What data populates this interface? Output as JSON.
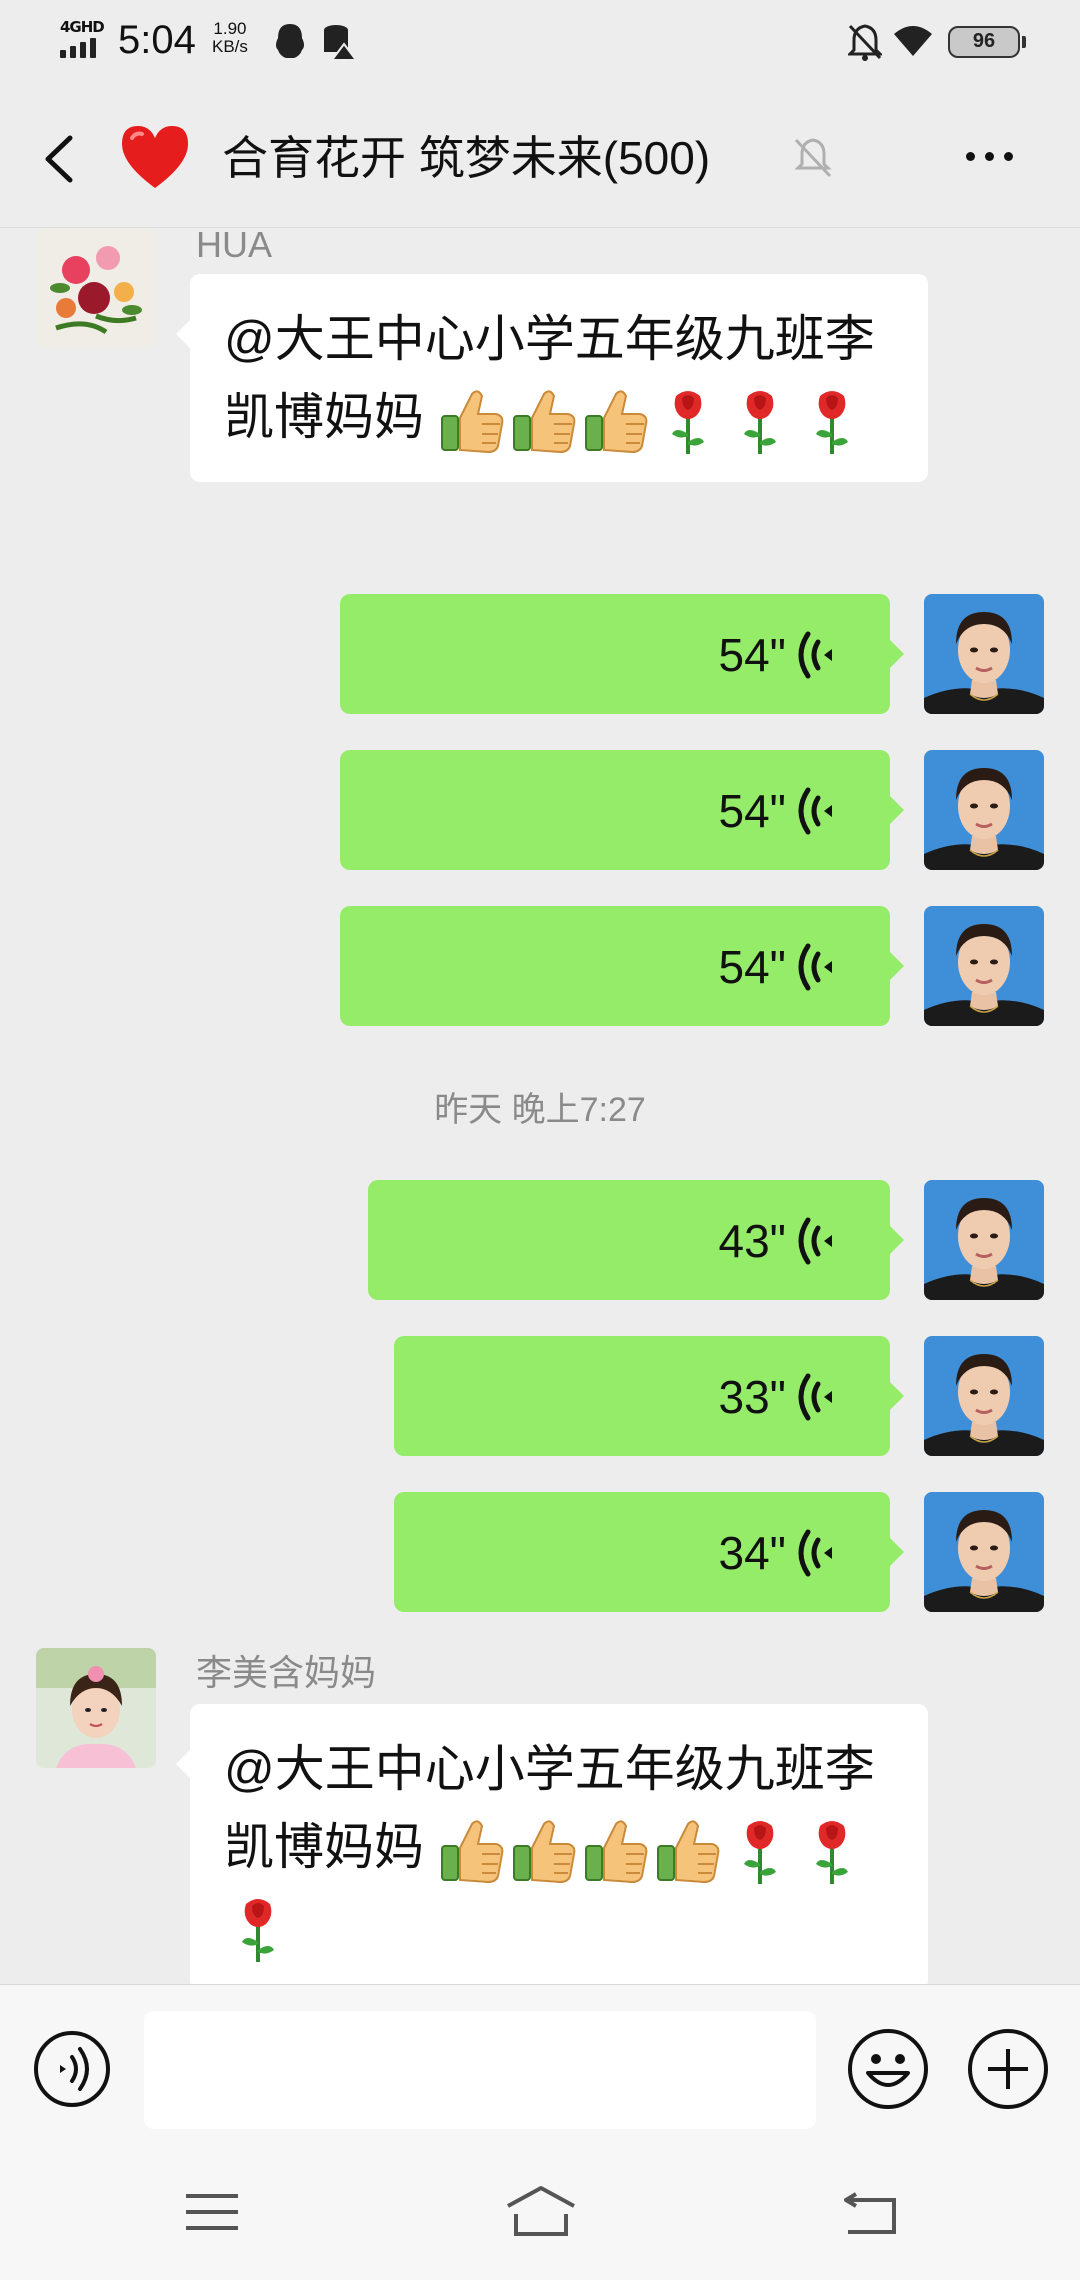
{
  "status_bar": {
    "network": "4GHD",
    "time": "5:04",
    "speed_value": "1.90",
    "speed_unit": "KB/s",
    "battery": "96",
    "icons": [
      "qq-icon",
      "database-alert-icon",
      "mute-bell-icon",
      "wifi-icon",
      "battery-icon"
    ]
  },
  "header": {
    "title": "合育花开 筑梦未来(500)",
    "icons": [
      "back-arrow-icon",
      "heart-emoji",
      "mute-icon",
      "more-icon"
    ]
  },
  "messages": [
    {
      "type": "text_in",
      "sender": "HUA",
      "text": "@大王中心小学五年级九班李凯博妈妈",
      "emoji": [
        "thumbs-up",
        "thumbs-up",
        "thumbs-up",
        "rose",
        "rose",
        "rose"
      ]
    },
    {
      "type": "voice_out",
      "duration": "54\""
    },
    {
      "type": "voice_out",
      "duration": "54\""
    },
    {
      "type": "voice_out",
      "duration": "54\""
    },
    {
      "type": "time",
      "text": "昨天 晚上7:27"
    },
    {
      "type": "voice_out",
      "duration": "43\""
    },
    {
      "type": "voice_out",
      "duration": "33\""
    },
    {
      "type": "voice_out",
      "duration": "34\""
    },
    {
      "type": "text_in",
      "sender": "李美含妈妈",
      "text": "@大王中心小学五年级九班李凯博妈妈",
      "emoji": [
        "thumbs-up",
        "thumbs-up",
        "thumbs-up",
        "thumbs-up",
        "rose",
        "rose",
        "rose"
      ]
    }
  ],
  "input_bar": {
    "icons": [
      "voice-input-icon",
      "emoji-icon",
      "plus-icon"
    ],
    "value": ""
  },
  "nav_bar": {
    "icons": [
      "menu-icon",
      "home-icon",
      "back-icon"
    ]
  },
  "colors": {
    "background": "#ededed",
    "out_bubble": "#95ec69",
    "in_bubble": "#ffffff",
    "muted_text": "#8a8a8a"
  }
}
